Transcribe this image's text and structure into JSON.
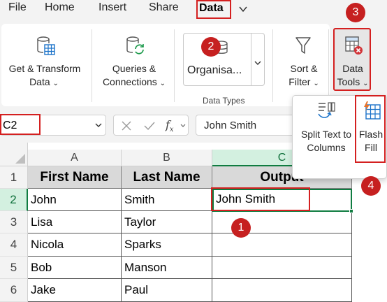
{
  "menu_tabs": {
    "file": "File",
    "home": "Home",
    "insert": "Insert",
    "share": "Share",
    "data": "Data"
  },
  "ribbon": {
    "get_transform_line1": "Get & Transform",
    "get_transform_line2": "Data",
    "queries_line1": "Queries &",
    "queries_line2": "Connections",
    "data_type_value": "Organisa...",
    "data_types_group": "Data Types",
    "sort_filter_line1": "Sort &",
    "sort_filter_line2": "Filter",
    "data_tools_line1": "Data",
    "data_tools_line2": "Tools"
  },
  "formula_bar": {
    "name_box": "C2",
    "formula": "John Smith"
  },
  "data_tools_menu": {
    "split_line1": "Split Text to",
    "split_line2": "Columns",
    "flash_line1": "Flash",
    "flash_line2": "Fill"
  },
  "grid": {
    "columns": [
      "A",
      "B",
      "C"
    ],
    "rows": [
      "1",
      "2",
      "3",
      "4",
      "5",
      "6"
    ],
    "headers": [
      "First Name",
      "Last Name",
      "Output"
    ],
    "data": [
      [
        "John",
        "Smith",
        "John Smith"
      ],
      [
        "Lisa",
        "Taylor",
        ""
      ],
      [
        "Nicola",
        "Sparks",
        ""
      ],
      [
        "Bob",
        "Manson",
        ""
      ],
      [
        "Jake",
        "Paul",
        ""
      ]
    ]
  },
  "steps": [
    "1",
    "2",
    "3",
    "4"
  ],
  "colors": {
    "highlight_red": "#d42020",
    "badge_red": "#c62020",
    "excel_green": "#107c41"
  }
}
